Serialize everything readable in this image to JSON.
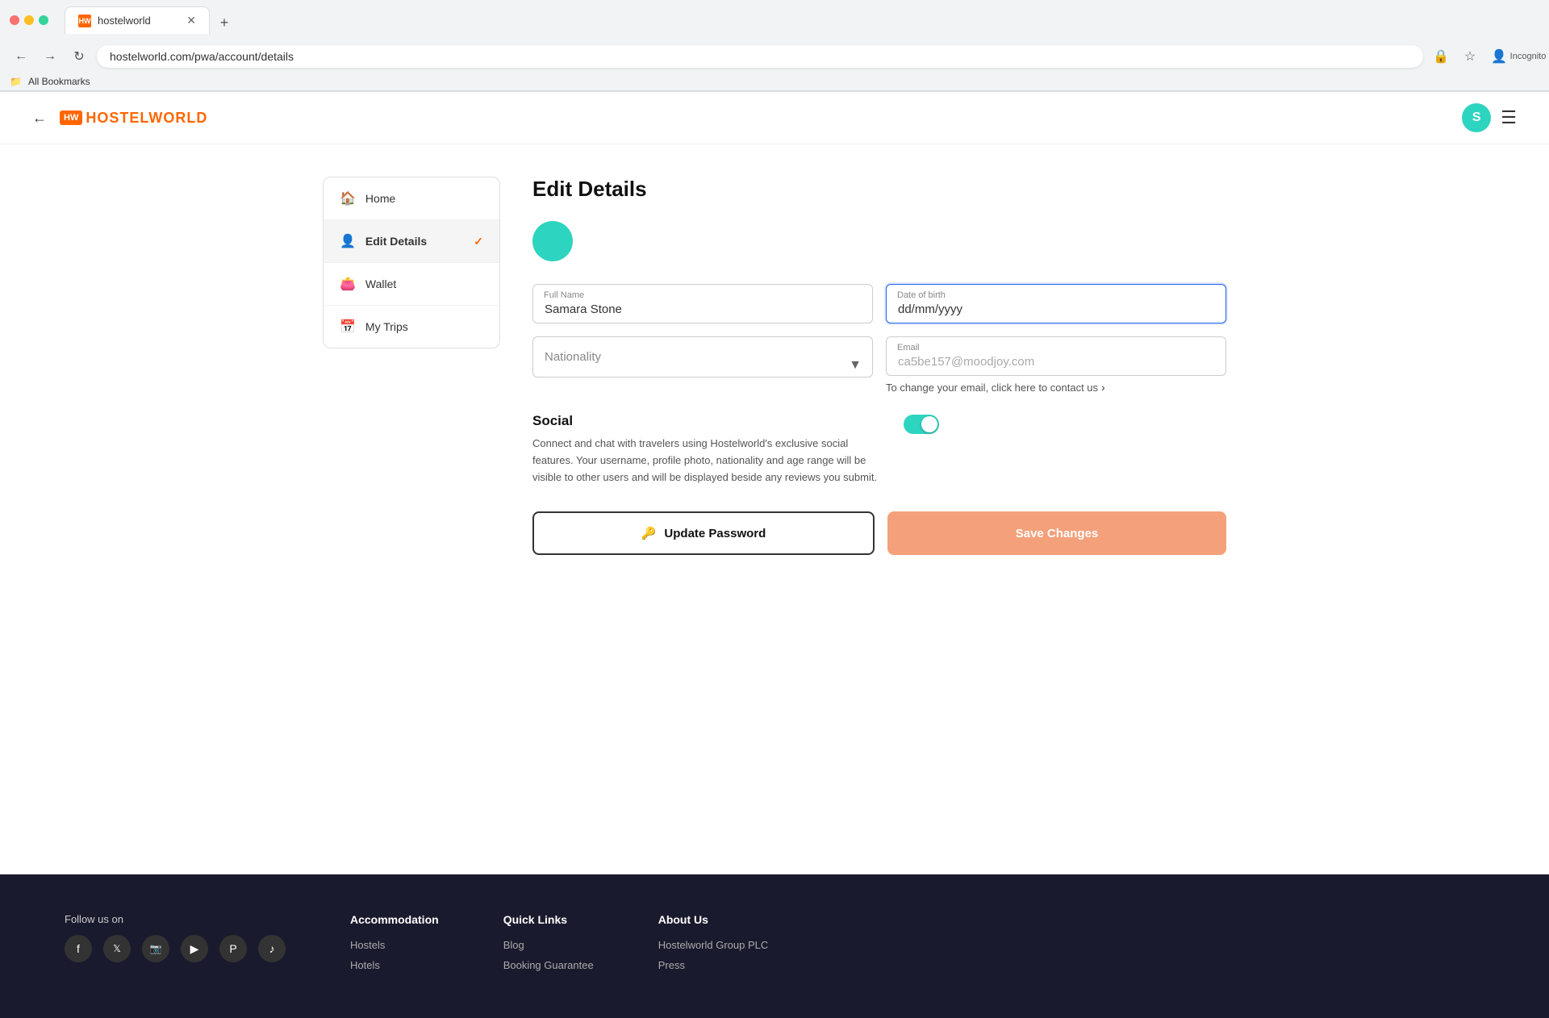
{
  "browser": {
    "tab_title": "hostelworld",
    "tab_favicon": "HW",
    "url": "hostelworld.com/pwa/account/details",
    "bookmarks_label": "All Bookmarks"
  },
  "header": {
    "logo_text": "HOSTELWORLD",
    "avatar_initial": "S",
    "back_label": "←"
  },
  "sidebar": {
    "items": [
      {
        "id": "home",
        "label": "Home",
        "icon": "🏠",
        "active": false
      },
      {
        "id": "edit-details",
        "label": "Edit Details",
        "icon": "👤",
        "active": true
      },
      {
        "id": "wallet",
        "label": "Wallet",
        "icon": "👛",
        "active": false
      },
      {
        "id": "my-trips",
        "label": "My Trips",
        "icon": "📅",
        "active": false
      }
    ]
  },
  "main": {
    "page_title": "Edit Details",
    "form": {
      "full_name_label": "Full Name",
      "full_name_value": "Samara Stone",
      "dob_label": "Date of birth",
      "dob_placeholder": "dd/mm/yyyy",
      "dob_selected_part": "dd",
      "nationality_placeholder": "Nationality",
      "email_label": "Email",
      "email_value": "ca5be157@moodjoy.com",
      "email_change_text": "To change your email, click here to contact us"
    },
    "social": {
      "title": "Social",
      "description": "Connect and chat with travelers using Hostelworld's exclusive social features. Your username, profile photo, nationality and age range will be visible to other users and will be displayed beside any reviews you submit.",
      "toggle_on": true
    },
    "buttons": {
      "update_password": "Update Password",
      "save_changes": "Save Changes",
      "password_icon": "🔑"
    }
  },
  "footer": {
    "follow_label": "Follow us on",
    "social_icons": [
      {
        "name": "facebook",
        "symbol": "f"
      },
      {
        "name": "twitter-x",
        "symbol": "𝕏"
      },
      {
        "name": "instagram",
        "symbol": "📷"
      },
      {
        "name": "youtube",
        "symbol": "▶"
      },
      {
        "name": "pinterest",
        "symbol": "P"
      },
      {
        "name": "tiktok",
        "symbol": "♪"
      }
    ],
    "accommodation": {
      "heading": "Accommodation",
      "links": [
        "Hostels",
        "Hotels"
      ]
    },
    "quick_links": {
      "heading": "Quick Links",
      "links": [
        "Blog",
        "Booking Guarantee"
      ]
    },
    "about": {
      "heading": "About Us",
      "links": [
        "Hostelworld Group PLC",
        "Press"
      ]
    }
  }
}
